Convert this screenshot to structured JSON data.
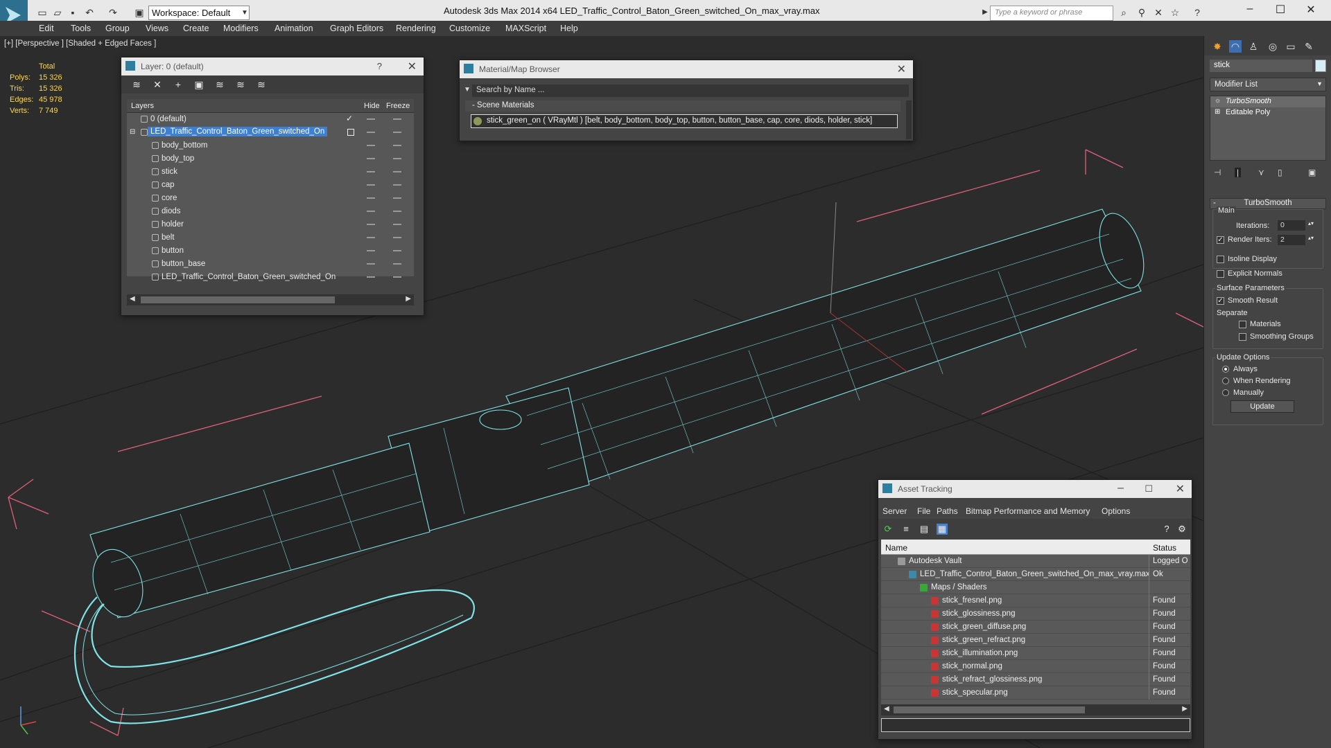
{
  "app": {
    "title": "Autodesk 3ds Max  2014 x64      LED_Traffic_Control_Baton_Green_switched_On_max_vray.max",
    "workspace": "Workspace: Default",
    "search_placeholder": "Type a keyword or phrase"
  },
  "menu": [
    "Edit",
    "Tools",
    "Group",
    "Views",
    "Create",
    "Modifiers",
    "Animation",
    "Graph Editors",
    "Rendering",
    "Customize",
    "MAXScript",
    "Help"
  ],
  "viewport": {
    "label": "[+] [Perspective ] [Shaded + Edged Faces ]",
    "stats": {
      "header": "Total",
      "rows": [
        {
          "k": "Polys:",
          "v": "15 326"
        },
        {
          "k": "Tris:",
          "v": "15 326"
        },
        {
          "k": "Edges:",
          "v": "45 978"
        },
        {
          "k": "Verts:",
          "v": "7 749"
        }
      ]
    }
  },
  "layer_panel": {
    "title": "Layer: 0 (default)",
    "col_layers": "Layers",
    "col_hide": "Hide",
    "col_freeze": "Freeze",
    "rows": [
      {
        "name": "0 (default)",
        "level": 0
      },
      {
        "name": "LED_Traffic_Control_Baton_Green_switched_On",
        "level": 0,
        "selected": true
      },
      {
        "name": "body_bottom",
        "level": 1
      },
      {
        "name": "body_top",
        "level": 1
      },
      {
        "name": "stick",
        "level": 1
      },
      {
        "name": "cap",
        "level": 1
      },
      {
        "name": "core",
        "level": 1
      },
      {
        "name": "diods",
        "level": 1
      },
      {
        "name": "holder",
        "level": 1
      },
      {
        "name": "belt",
        "level": 1
      },
      {
        "name": "button",
        "level": 1
      },
      {
        "name": "button_base",
        "level": 1
      },
      {
        "name": "LED_Traffic_Control_Baton_Green_switched_On",
        "level": 1
      }
    ]
  },
  "material_browser": {
    "title": "Material/Map Browser",
    "search_placeholder": "Search by Name ...",
    "section": "Scene Materials",
    "entry": "stick_green_on  ( VRayMtl ) [belt, body_bottom, body_top, button, button_base, cap, core, diods, holder, stick]"
  },
  "asset_tracking": {
    "title": "Asset Tracking",
    "menu": [
      "Server",
      "File",
      "Paths",
      "Bitmap Performance and Memory",
      "Options"
    ],
    "col_name": "Name",
    "col_status": "Status",
    "rows": [
      {
        "name": "Autodesk Vault",
        "status": "Logged O",
        "level": 0,
        "icon": "vault-icon"
      },
      {
        "name": "LED_Traffic_Control_Baton_Green_switched_On_max_vray.max",
        "status": "Ok",
        "level": 1,
        "icon": "max-file-icon"
      },
      {
        "name": "Maps / Shaders",
        "status": "",
        "level": 2,
        "icon": "maps-icon"
      },
      {
        "name": "stick_fresnel.png",
        "status": "Found",
        "level": 3,
        "icon": "png-icon"
      },
      {
        "name": "stick_glossiness.png",
        "status": "Found",
        "level": 3,
        "icon": "png-icon"
      },
      {
        "name": "stick_green_diffuse.png",
        "status": "Found",
        "level": 3,
        "icon": "png-icon"
      },
      {
        "name": "stick_green_refract.png",
        "status": "Found",
        "level": 3,
        "icon": "png-icon"
      },
      {
        "name": "stick_illumination.png",
        "status": "Found",
        "level": 3,
        "icon": "png-icon"
      },
      {
        "name": "stick_normal.png",
        "status": "Found",
        "level": 3,
        "icon": "png-icon"
      },
      {
        "name": "stick_refract_glossiness.png",
        "status": "Found",
        "level": 3,
        "icon": "png-icon"
      },
      {
        "name": "stick_specular.png",
        "status": "Found",
        "level": 3,
        "icon": "png-icon"
      }
    ]
  },
  "command_panel": {
    "object_name": "stick",
    "modifier_list": "Modifier List",
    "stack": [
      "TurboSmooth",
      "Editable Poly"
    ],
    "rollout": "TurboSmooth",
    "main_label": "Main",
    "iterations_label": "Iterations:",
    "iterations_value": "0",
    "render_iters_label": "Render Iters:",
    "render_iters_value": "2",
    "isoline": "Isoline Display",
    "explicit_normals": "Explicit Normals",
    "surface_params": "Surface Parameters",
    "smooth_result": "Smooth Result",
    "separate": "Separate",
    "materials": "Materials",
    "smoothing_groups": "Smoothing Groups",
    "update_options": "Update Options",
    "always": "Always",
    "when_rendering": "When Rendering",
    "manually": "Manually",
    "update_button": "Update"
  },
  "colors": {
    "wire": "#7fe3e6",
    "selection": "#3d7fd0",
    "stats": "#ffd94a",
    "bbox": "#e0607a"
  }
}
